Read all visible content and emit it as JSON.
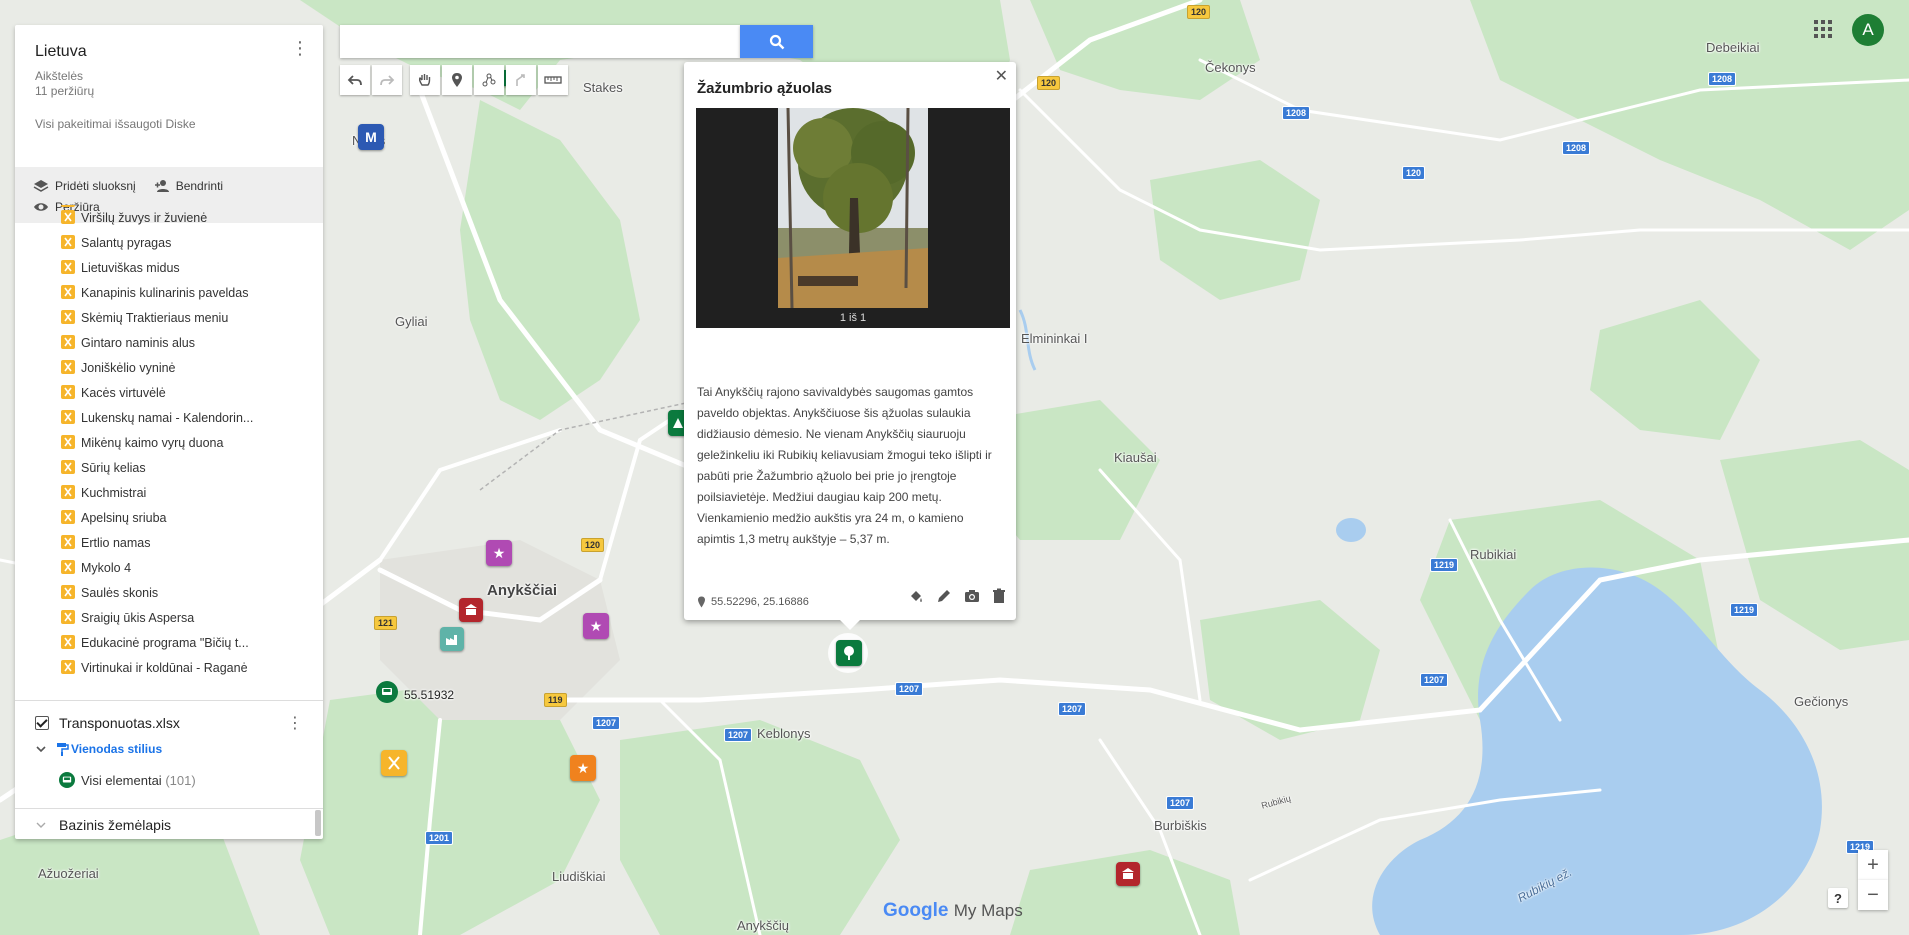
{
  "panel": {
    "title": "Lietuva",
    "category": "Aikštelės",
    "views": "11 peržiūrų",
    "saved": "Visi pakeitimai išsaugoti Diske",
    "actions": {
      "add_layer": "Pridėti sluoksnį",
      "share": "Bendrinti",
      "preview": "Peržiūra"
    },
    "items": [
      "Viršilų žuvys ir žuvienė",
      "Salantų pyragas",
      "Lietuviškas midus",
      "Kanapinis kulinarinis paveldas",
      "Skėmių Traktieriaus meniu",
      "Gintaro naminis alus",
      "Joniškėlio vyninė",
      "Kacės virtuvėlė",
      "Lukenskų namai - Kalendorin...",
      "Mikėnų kaimo vyrų duona",
      "Sūrių kelias",
      "Kuchmistrai",
      "Apelsinų sriuba",
      "Ertlio namas",
      "Mykolo 4",
      "Saulės skonis",
      "Sraigių ūkis Aspersa",
      "Edukacinė programa \"Bičių t...",
      "Virtinukai ir koldūnai - Raganė"
    ],
    "layer2": {
      "name": "Transponuotas.xlsx",
      "style": "Vienodas stilius",
      "all_elements": "Visi elementai",
      "count": "(101)"
    },
    "basemap": "Bazinis žemėlapis"
  },
  "search": {
    "placeholder": "",
    "value": ""
  },
  "popup": {
    "title": "Žažumbrio ąžuolas",
    "photo_caption": "1 iš 1",
    "description": "Tai Anykščių rajono savivaldybės saugomas gamtos paveldo objektas. Anykščiuose šis ąžuolas sulaukia didžiausio dėmesio. Ne vienam Anykščių siauruoju geležinkeliu iki Rubikių keliavusiam žmogui teko išlipti ir pabūti prie Žažumbrio ąžuolo bei prie jo įrengtoje poilsiavietėje. Medžiui daugiau kaip 200 metų. Vienkamienio medžio aukštis yra 24 m, o kamieno apimtis 1,3 metrų aukštyje – 5,37 m.",
    "coords": "55.52296, 25.16886"
  },
  "user": {
    "avatar_letter": "A"
  },
  "map": {
    "places": {
      "stakes": "Stakes",
      "nynys": "N    nys",
      "cekonys": "Čekonys",
      "debeikiai": "Debeikiai",
      "gyliai": "Gyliai",
      "elminink": "Elmininkai I",
      "kiausai": "Kiaušai",
      "rubikiai": "Rubikiai",
      "anyksciai": "Anykščiai",
      "coordlabel": "55.51932",
      "keblonys": "Keblonys",
      "geciionys": "Gečionys",
      "burbiskis": "Burbiškis",
      "liudiskiai": "Liudiškiai",
      "azuozeriai": "Ažuožeriai",
      "anyksciai2": "Anykščių",
      "rubikiu_ez": "Rubikių ež.",
      "rubikiu_road": "Rubikių"
    },
    "roads": [
      "120",
      "120",
      "1208",
      "1208",
      "1208",
      "120",
      "121",
      "119",
      "1207",
      "1207",
      "1207",
      "1207",
      "1207",
      "1219",
      "1219",
      "1207",
      "1219",
      "1201"
    ],
    "marker_letters": {
      "m": "M"
    }
  },
  "brand": {
    "google": "Google",
    "mymaps": "My Maps"
  },
  "colors": {
    "accent": "#4a8af4",
    "list_icon": "#f6b52b",
    "avatar": "#1e7e34",
    "green_pin": "#0b7a3e"
  }
}
